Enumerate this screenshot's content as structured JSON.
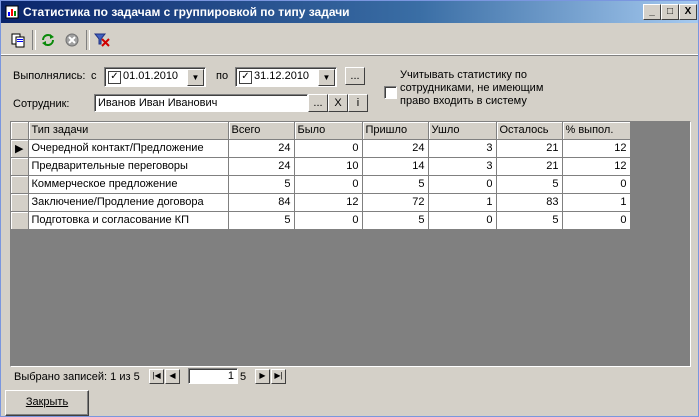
{
  "window": {
    "title": "Статистика по задачам с группировкой по типу задачи"
  },
  "titlebar_buttons": {
    "minimize": "_",
    "maximize": "□",
    "close": "X"
  },
  "filters": {
    "executed_label": "Выполнялись:",
    "from_label": "с",
    "from_date": "01.01.2010",
    "to_label": "по",
    "to_date": "31.12.2010",
    "ellipsis": "...",
    "employee_label": "Сотрудник:",
    "employee_value": "Иванов Иван Иванович",
    "clear_symbol": "X",
    "info_symbol": "i",
    "inactive_stats_label": "Учитывать статистику по сотрудниками, не имеющим право входить в систему"
  },
  "grid": {
    "columns": [
      "Тип задачи",
      "Всего",
      "Было",
      "Пришло",
      "Ушло",
      "Осталось",
      "% выпол."
    ],
    "rows": [
      [
        "Очередной контакт/Предложение",
        "24",
        "0",
        "24",
        "3",
        "21",
        "12"
      ],
      [
        "Предварительные переговоры",
        "24",
        "10",
        "14",
        "3",
        "21",
        "12"
      ],
      [
        "Коммерческое предложение",
        "5",
        "0",
        "5",
        "0",
        "5",
        "0"
      ],
      [
        "Заключение/Продление договора",
        "84",
        "12",
        "72",
        "1",
        "83",
        "1"
      ],
      [
        "Подготовка и согласование КП",
        "5",
        "0",
        "5",
        "0",
        "5",
        "0"
      ]
    ]
  },
  "status": {
    "selected_text": "Выбрано записей: 1 из 5",
    "page_value": "1",
    "page_total": "5"
  },
  "footer": {
    "close_label": "Закрыть"
  },
  "colors": {
    "title_start": "#0a246a",
    "title_end": "#a6caf0",
    "face": "#d4d0c8"
  }
}
